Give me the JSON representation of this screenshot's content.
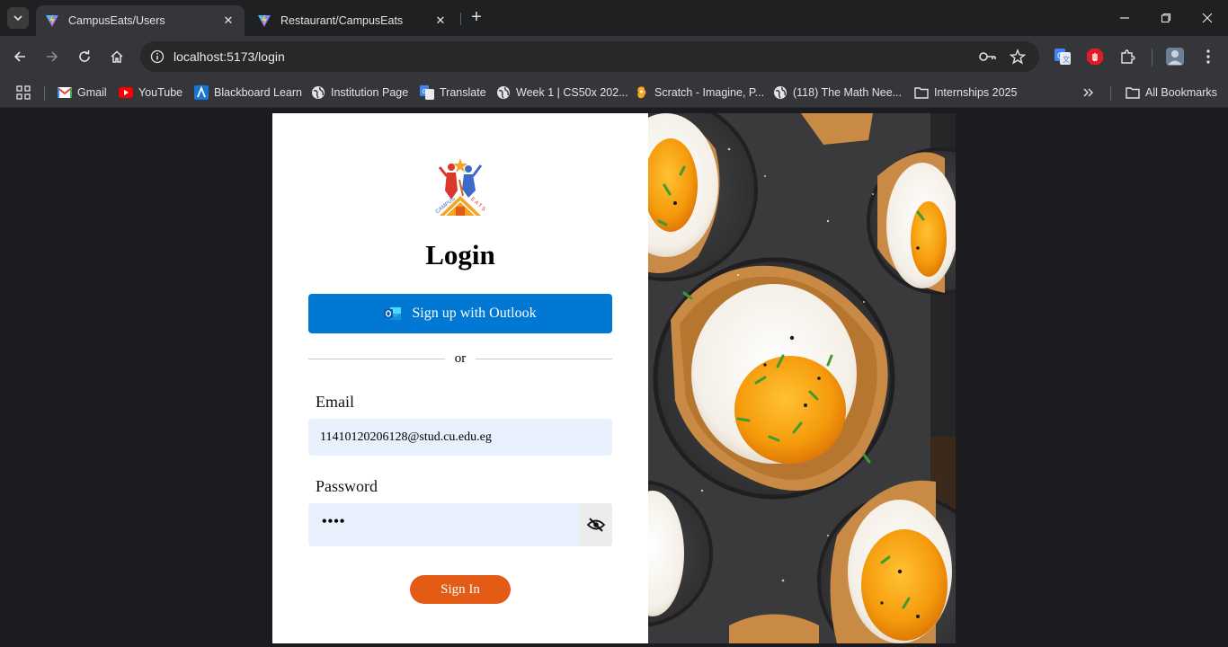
{
  "browser": {
    "tabs": [
      {
        "title": "CampusEats/Users",
        "active": true
      },
      {
        "title": "Restaurant/CampusEats",
        "active": false
      }
    ],
    "url": "localhost:5173/login",
    "bookmarks": [
      {
        "label": "Gmail",
        "icon": "gmail-icon"
      },
      {
        "label": "YouTube",
        "icon": "youtube-icon"
      },
      {
        "label": "Blackboard Learn",
        "icon": "blackboard-icon"
      },
      {
        "label": "Institution Page",
        "icon": "globe-icon"
      },
      {
        "label": "Translate",
        "icon": "translate-icon"
      },
      {
        "label": "Week 1 | CS50x 202...",
        "icon": "globe-icon"
      },
      {
        "label": "Scratch - Imagine, P...",
        "icon": "scratch-icon"
      },
      {
        "label": "(118) The Math Nee...",
        "icon": "globe-icon"
      },
      {
        "label": "Internships 2025",
        "icon": "folder-icon"
      }
    ],
    "all_bookmarks_label": "All Bookmarks"
  },
  "login": {
    "heading": "Login",
    "outlook_button": "Sign up with Outlook",
    "divider": "or",
    "email_label": "Email",
    "email_value": "11410120206128@stud.cu.edu.eg",
    "password_label": "Password",
    "password_masked": "••••",
    "submit_button": "Sign In"
  },
  "colors": {
    "outlook_blue": "#0078d4",
    "signin_orange": "#e35b14",
    "input_bg": "#e8f0fe"
  }
}
